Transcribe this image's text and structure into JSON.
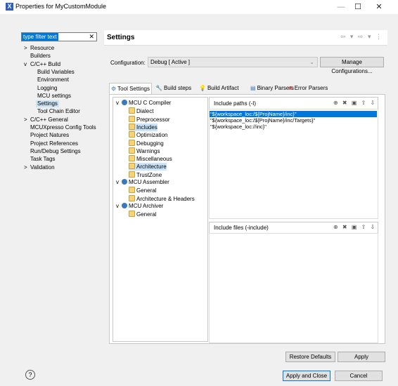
{
  "window": {
    "title": "Properties for MyCustomModule",
    "minimize": "—",
    "maximize": "☐",
    "close": "✕"
  },
  "filter": {
    "value": "type filter text",
    "clear": "✕"
  },
  "nav": {
    "items": [
      {
        "label": "Resource",
        "exp": ">",
        "level": 0
      },
      {
        "label": "Builders",
        "exp": "",
        "level": 0
      },
      {
        "label": "C/C++ Build",
        "exp": "v",
        "level": 0
      },
      {
        "label": "Build Variables",
        "exp": "",
        "level": 1
      },
      {
        "label": "Environment",
        "exp": "",
        "level": 1
      },
      {
        "label": "Logging",
        "exp": "",
        "level": 1
      },
      {
        "label": "MCU settings",
        "exp": "",
        "level": 1
      },
      {
        "label": "Settings",
        "exp": "",
        "level": 1
      },
      {
        "label": "Tool Chain Editor",
        "exp": "",
        "level": 1
      },
      {
        "label": "C/C++ General",
        "exp": ">",
        "level": 0
      },
      {
        "label": "MCUXpresso Config Tools",
        "exp": "",
        "level": 0
      },
      {
        "label": "Project Natures",
        "exp": "",
        "level": 0
      },
      {
        "label": "Project References",
        "exp": "",
        "level": 0
      },
      {
        "label": "Run/Debug Settings",
        "exp": "",
        "level": 0
      },
      {
        "label": "Task Tags",
        "exp": "",
        "level": 0
      },
      {
        "label": "Validation",
        "exp": ">",
        "level": 0
      }
    ]
  },
  "header": {
    "title": "Settings",
    "nav": "⇦ ▾ ⇨ ▾ ⋮"
  },
  "config": {
    "label": "Configuration:",
    "value": "Debug  [ Active ]",
    "arrow": "⌄",
    "manage": "Manage Configurations..."
  },
  "tabs": [
    "Tool Settings",
    "Build steps",
    "Build Artifact",
    "Binary Parsers",
    "Error Parsers"
  ],
  "tree": [
    {
      "label": "MCU C Compiler",
      "exp": "v",
      "icon": "tool",
      "level": 0
    },
    {
      "label": "Dialect",
      "exp": "",
      "icon": "folder",
      "level": 1
    },
    {
      "label": "Preprocessor",
      "exp": "",
      "icon": "folder",
      "level": 1
    },
    {
      "label": "Includes",
      "exp": "",
      "icon": "folder",
      "level": 1
    },
    {
      "label": "Optimization",
      "exp": "",
      "icon": "folder",
      "level": 1
    },
    {
      "label": "Debugging",
      "exp": "",
      "icon": "folder",
      "level": 1
    },
    {
      "label": "Warnings",
      "exp": "",
      "icon": "folder",
      "level": 1
    },
    {
      "label": "Miscellaneous",
      "exp": "",
      "icon": "folder",
      "level": 1
    },
    {
      "label": "Architecture",
      "exp": "",
      "icon": "folder",
      "level": 1
    },
    {
      "label": "TrustZone",
      "exp": "",
      "icon": "folder",
      "level": 1
    },
    {
      "label": "MCU Assembler",
      "exp": "v",
      "icon": "tool",
      "level": 0
    },
    {
      "label": "General",
      "exp": "",
      "icon": "folder",
      "level": 1
    },
    {
      "label": "Architecture & Headers",
      "exp": "",
      "icon": "folder",
      "level": 1
    },
    {
      "label": "MCU Archiver",
      "exp": "v",
      "icon": "tool",
      "level": 0
    },
    {
      "label": "General",
      "exp": "",
      "icon": "folder",
      "level": 1
    }
  ],
  "include_paths": {
    "title": "Include paths (-I)",
    "tools": "⊕ ✖ ▣ ⇧ ⇩",
    "items": [
      "\"${workspace_loc:/${ProjName}/inc}\"",
      "\"${workspace_loc:/${ProjName}/inc/Targets}\"",
      "\"${workspace_loc://inc}\""
    ]
  },
  "include_files": {
    "title": "Include files (-include)",
    "tools": "⊕ ✖ ▣ ⇧ ⇩"
  },
  "buttons": {
    "restore": "Restore Defaults",
    "apply": "Apply",
    "apply_close": "Apply and Close",
    "cancel": "Cancel",
    "help": "?"
  }
}
